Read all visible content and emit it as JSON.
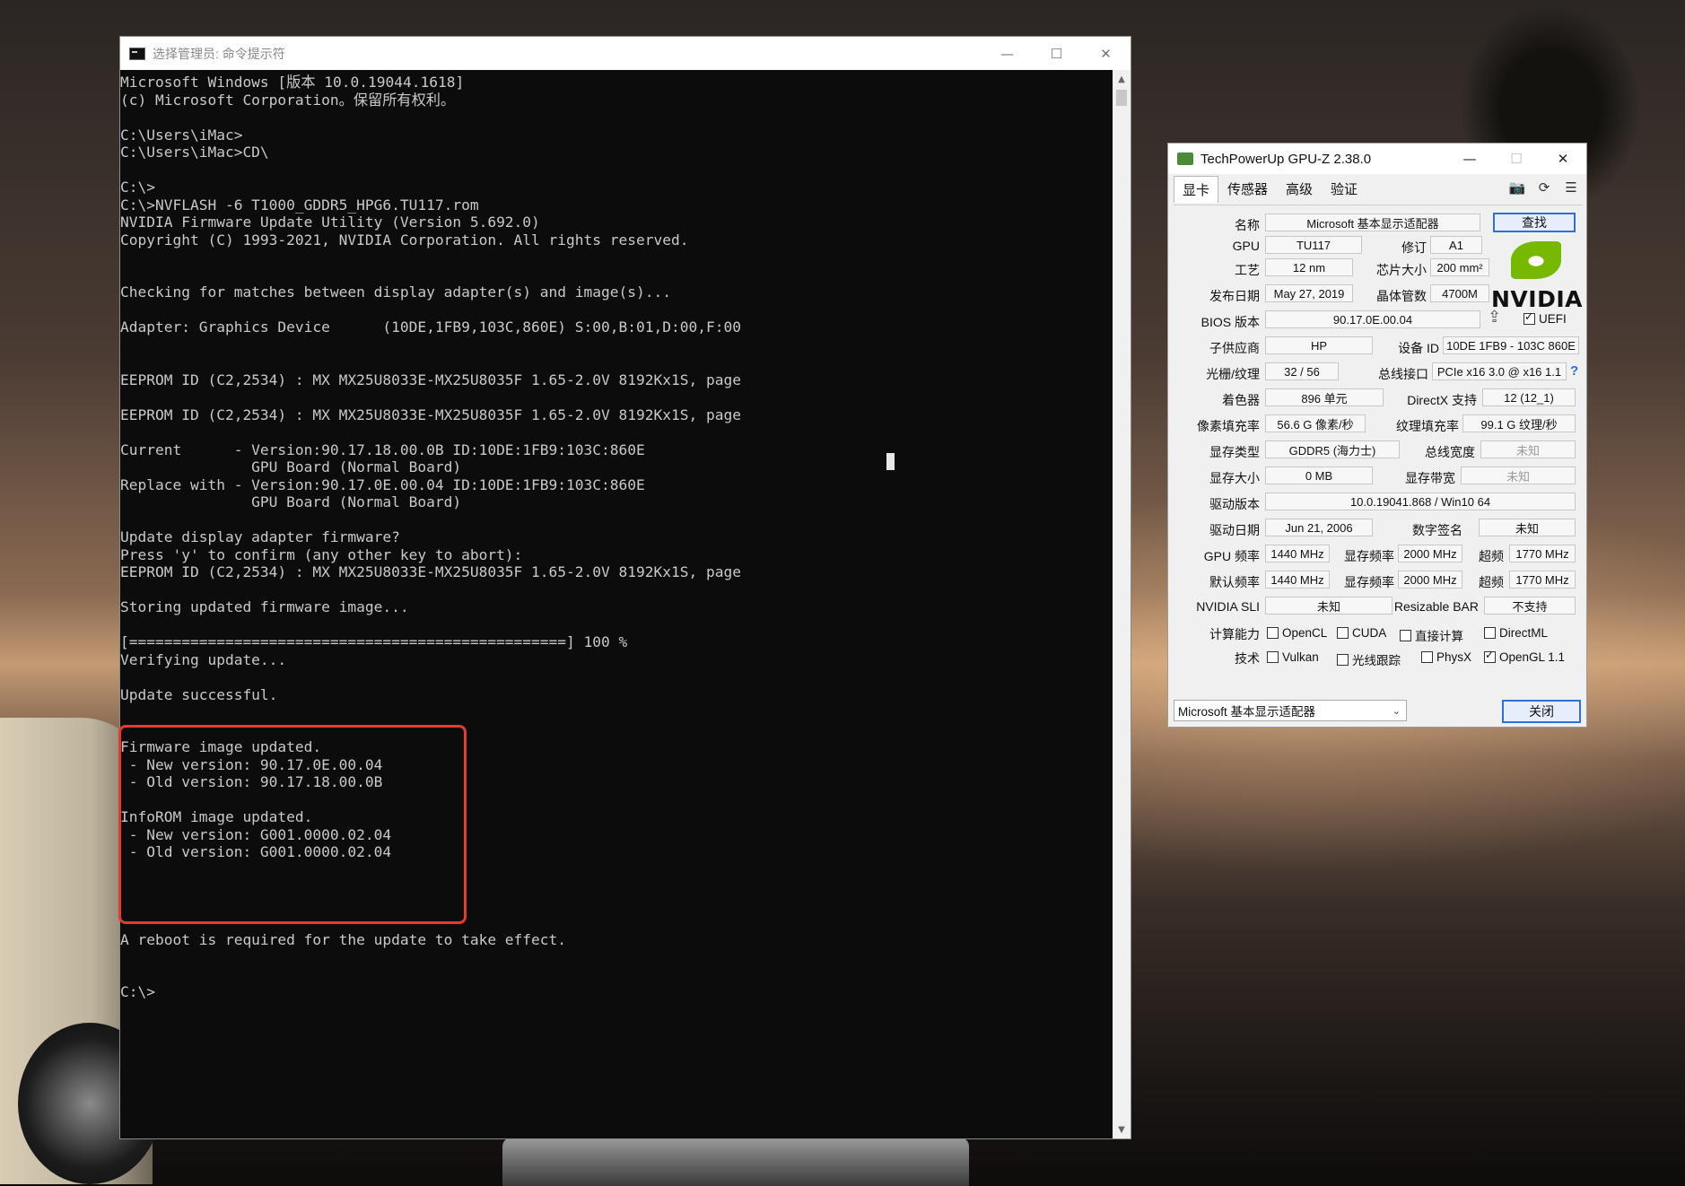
{
  "cmd": {
    "title": "选择管理员: 命令提示符",
    "lines": [
      "Microsoft Windows [版本 10.0.19044.1618]",
      "(c) Microsoft Corporation。保留所有权利。",
      "",
      "C:\\Users\\iMac>",
      "C:\\Users\\iMac>CD\\",
      "",
      "C:\\>",
      "C:\\>NVFLASH -6 T1000_GDDR5_HPG6.TU117.rom",
      "NVIDIA Firmware Update Utility (Version 5.692.0)",
      "Copyright (C) 1993-2021, NVIDIA Corporation. All rights reserved.",
      "",
      "",
      "Checking for matches between display adapter(s) and image(s)...",
      "",
      "Adapter: Graphics Device      (10DE,1FB9,103C,860E) S:00,B:01,D:00,F:00",
      "",
      "",
      "EEPROM ID (C2,2534) : MX MX25U8033E-MX25U8035F 1.65-2.0V 8192Kx1S, page",
      "",
      "EEPROM ID (C2,2534) : MX MX25U8033E-MX25U8035F 1.65-2.0V 8192Kx1S, page",
      "",
      "Current      - Version:90.17.18.00.0B ID:10DE:1FB9:103C:860E",
      "               GPU Board (Normal Board)",
      "Replace with - Version:90.17.0E.00.04 ID:10DE:1FB9:103C:860E",
      "               GPU Board (Normal Board)",
      "",
      "Update display adapter firmware?",
      "Press 'y' to confirm (any other key to abort):",
      "EEPROM ID (C2,2534) : MX MX25U8033E-MX25U8035F 1.65-2.0V 8192Kx1S, page",
      "",
      "Storing updated firmware image...",
      "",
      "[==================================================] 100 %",
      "Verifying update...",
      "",
      "Update successful.",
      "",
      "",
      "Firmware image updated.",
      " - New version: 90.17.0E.00.04",
      " - Old version: 90.17.18.00.0B",
      "",
      "InfoROM image updated.",
      " - New version: G001.0000.02.04",
      " - Old version: G001.0000.02.04",
      "",
      "",
      "",
      "",
      "A reboot is required for the update to take effect.",
      "",
      "",
      "C:\\>"
    ]
  },
  "gpuz": {
    "title": "TechPowerUp GPU-Z 2.38.0",
    "tabs": [
      "显卡",
      "传感器",
      "高级",
      "验证"
    ],
    "vendor_logo_text": "NVIDIA",
    "lookup_button": "查找",
    "labels": {
      "name": "名称",
      "gpu": "GPU",
      "revision": "修订",
      "process": "工艺",
      "die_size": "芯片大小",
      "release_date": "发布日期",
      "transistors": "晶体管数",
      "bios": "BIOS 版本",
      "subvendor": "子供应商",
      "device_id": "设备 ID",
      "rops": "光栅/纹理",
      "bus": "总线接口",
      "shaders": "着色器",
      "directx": "DirectX 支持",
      "pixel_fill": "像素填充率",
      "texture_fill": "纹理填充率",
      "mem_type": "显存类型",
      "bus_width": "总线宽度",
      "mem_size": "显存大小",
      "bandwidth": "显存带宽",
      "driver_ver": "驱动版本",
      "driver_date": "驱动日期",
      "digital_sig": "数字签名",
      "gpu_clock": "GPU 频率",
      "mem_clock": "显存频率",
      "boost": "超频",
      "default_clock": "默认频率",
      "sli": "NVIDIA SLI",
      "resizable_bar": "Resizable BAR",
      "compute": "计算能力",
      "tech": "技术"
    },
    "values": {
      "name": "Microsoft 基本显示适配器",
      "gpu": "TU117",
      "revision": "A1",
      "process": "12 nm",
      "die_size": "200 mm²",
      "release_date": "May 27, 2019",
      "transistors": "4700M",
      "bios": "90.17.0E.00.04",
      "uefi": "UEFI",
      "subvendor": "HP",
      "device_id": "10DE 1FB9 - 103C 860E",
      "rops": "32 / 56",
      "bus": "PCIe x16 3.0 @ x16 1.1",
      "shaders": "896 单元",
      "directx": "12 (12_1)",
      "pixel_fill": "56.6 G 像素/秒",
      "texture_fill": "99.1 G 纹理/秒",
      "mem_type": "GDDR5 (海力士)",
      "bus_width": "未知",
      "mem_size": "0 MB",
      "bandwidth": "未知",
      "driver_ver": "10.0.19041.868 / Win10 64",
      "driver_date": "Jun 21, 2006",
      "digital_sig": "未知",
      "gpu_clock": "1440 MHz",
      "mem_clock": "2000 MHz",
      "boost": "1770 MHz",
      "default_clock": "1440 MHz",
      "default_mem_clock": "2000 MHz",
      "default_boost": "1770 MHz",
      "sli": "未知",
      "resizable_bar": "不支持"
    },
    "compute_checks": [
      {
        "label": "OpenCL",
        "checked": false
      },
      {
        "label": "CUDA",
        "checked": false
      },
      {
        "label": "直接计算",
        "checked": false
      },
      {
        "label": "DirectML",
        "checked": false
      }
    ],
    "tech_checks": [
      {
        "label": "Vulkan",
        "checked": false
      },
      {
        "label": "光线跟踪",
        "checked": false
      },
      {
        "label": "PhysX",
        "checked": false
      },
      {
        "label": "OpenGL 1.1",
        "checked": true
      }
    ],
    "adapter_select": "Microsoft 基本显示适配器",
    "close_button": "关闭"
  }
}
